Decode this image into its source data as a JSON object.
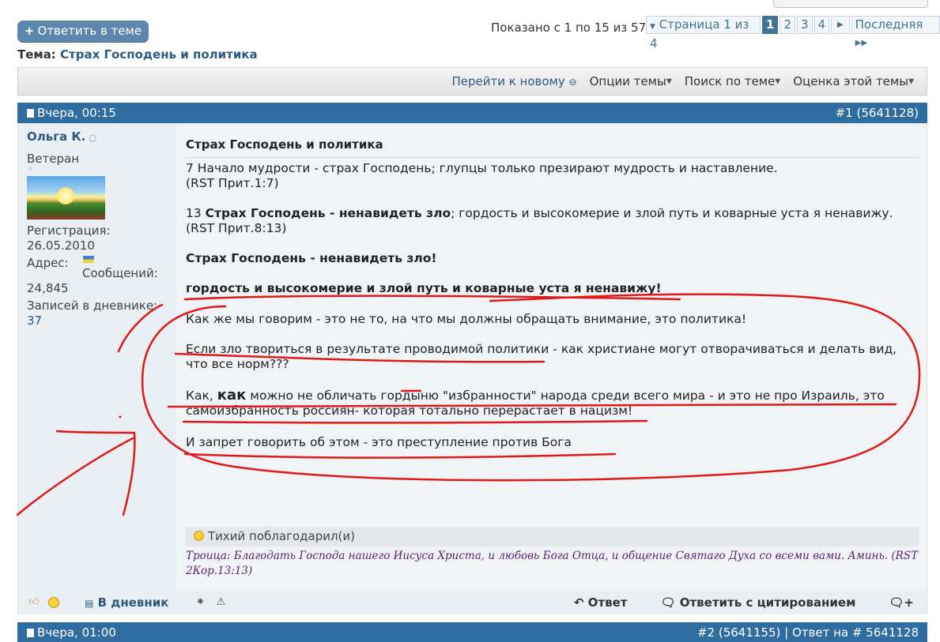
{
  "header": {
    "reply_button": "Ответить в теме",
    "reply_plus": "+",
    "pager_info": "Показано с 1 по 15 из 57",
    "page_label": "Страница 1 из 4",
    "pages": [
      "1",
      "2",
      "3",
      "4"
    ],
    "last_label": "Последняя",
    "thread_prefix": "Тема:",
    "thread_title": "Страх Господень и политика"
  },
  "toolbar": {
    "goto_new": "Перейти к новому",
    "thread_options": "Опции темы",
    "search_thread": "Поиск по теме",
    "rate_thread": "Оценка этой темы"
  },
  "post1": {
    "date": "Вчера, 00:15",
    "number": "#1 (5641128)",
    "user": {
      "name": "Ольга К.",
      "title": "Ветеран",
      "reg_label": "Регистрация:",
      "reg_date": "26.05.2010",
      "address_label": "Адрес:",
      "messages_label": "Сообщений:",
      "messages_count": "24,845",
      "diary_label": "Записей в дневнике:",
      "diary_count": "37"
    },
    "title": "Страх Господень и политика",
    "p1_a": "7 Начало мудрости - страх Господень; глупцы только презирают мудрость и наставление.",
    "p1_b": "(RST Прит.1:7)",
    "p2_num": "13",
    "p2_bold": "Страх Господень - ненавидеть зло",
    "p2_rest": "; гордость и высокомерие и злой путь и коварные уста я ненавижу.",
    "p2_b": "(RST Прит.8:13)",
    "p3": "Страх Господень - ненавидеть зло!",
    "p4": "гордость и высокомерие и злой путь и коварные уста я ненавижу!",
    "p5": "Как же мы говорим - это не то, на что мы должны обращать внимание, это политика!",
    "p6_a": "Если зло твориться в результате проводимой политики - как христиане могут отворачиваться и делать вид,",
    "p6_b": "что все норм???",
    "p7_a_pre": "Как,",
    "p7_a_big": "как",
    "p7_a_post": "можно не обличать гордыню \"избранности\" народа среди всего мира - и это не про Израиль, это",
    "p7_b": "самоизбранность россиян- которая тотально перерастает в нацизм!",
    "p8": "И запрет говорить об этом - это преступление против Бога",
    "thanks": "Тихий поблагодарил(и)",
    "signature": "Троица: Благодать Господа нашего Иисуса Христа, и любовь Бога Отца, и общение Святаго Духа со всеми вами. Аминь. (RST 2Кор.13:13)"
  },
  "footer": {
    "diary": "В дневник",
    "reply": "Ответ",
    "reply_quote": "Ответить с цитированием"
  },
  "post2": {
    "date": "Вчера, 01:00",
    "number": "#2 (5641155) | Ответ на # 5641128"
  },
  "colors": {
    "postbar": "#2f6ca0",
    "link": "#2d5a82",
    "annotation": "#e01818"
  }
}
